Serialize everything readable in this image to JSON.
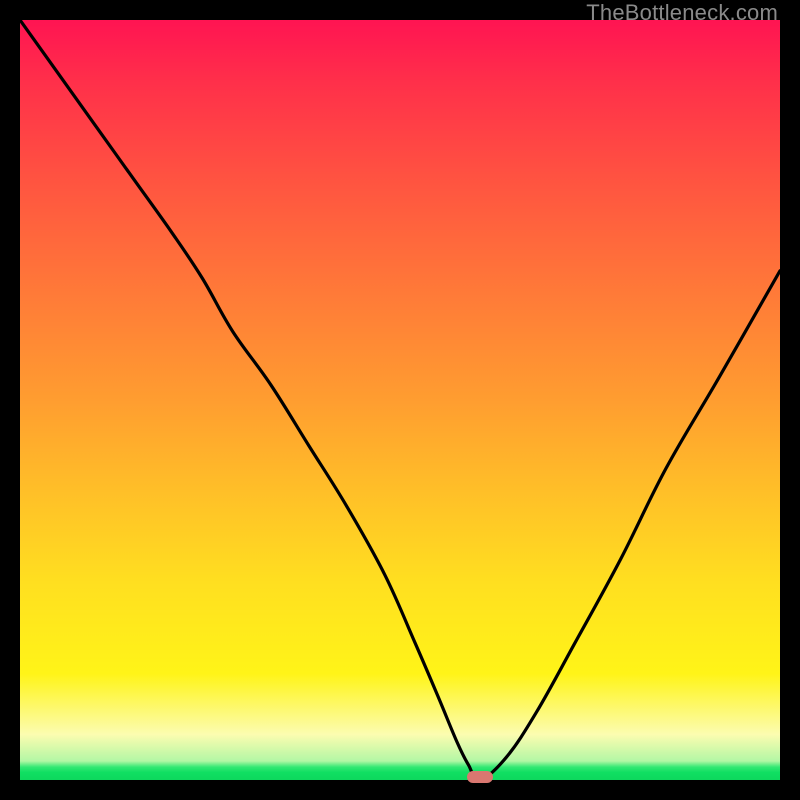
{
  "watermark": "TheBottleneck.com",
  "colors": {
    "frame_bg": "#000000",
    "curve_stroke": "#000000",
    "marker_fill": "#d97770",
    "gradient_stops": [
      "#ff1452",
      "#ff2f4a",
      "#ff5640",
      "#ff7a38",
      "#ff9d30",
      "#ffbf28",
      "#ffdf20",
      "#fff418",
      "#fcfcb0",
      "#b3f7a5",
      "#33e873",
      "#10df62",
      "#0dd85d"
    ]
  },
  "chart_data": {
    "type": "line",
    "title": "",
    "xlabel": "",
    "ylabel": "",
    "xlim": [
      0,
      100
    ],
    "ylim": [
      0,
      100
    ],
    "grid": false,
    "legend": "none",
    "series": [
      {
        "name": "bottleneck-curve",
        "x": [
          0,
          5,
          10,
          15,
          20,
          24,
          28,
          33,
          38,
          43,
          48,
          52,
          55,
          57.5,
          59,
          60.5,
          64,
          68,
          73,
          79,
          85,
          92,
          100
        ],
        "values": [
          100,
          93,
          86,
          79,
          72,
          66,
          59,
          52,
          44,
          36,
          27,
          18,
          11,
          5,
          2,
          0,
          3,
          9,
          18,
          29,
          41,
          53,
          67
        ]
      }
    ],
    "annotations": [
      {
        "name": "minimum-marker",
        "x": 60.5,
        "y": 0,
        "shape": "pill",
        "color": "#d97770"
      }
    ]
  }
}
